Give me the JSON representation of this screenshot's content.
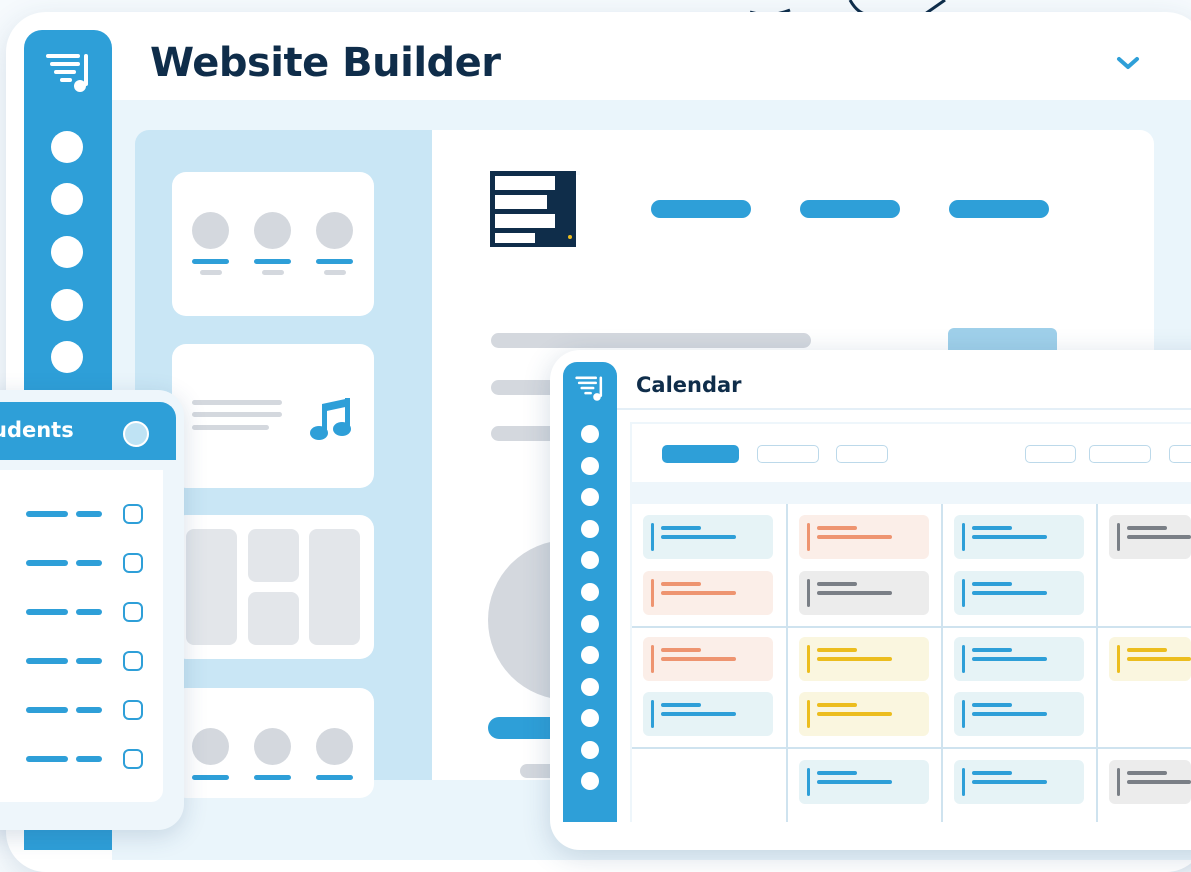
{
  "app": {
    "title": "Website Builder",
    "accent_color": "#2e9fd8",
    "logo_icon": "playlist-music-icon",
    "dropdown_icon": "chevron-down-icon"
  },
  "students_panel": {
    "title": "udents",
    "rows": 6
  },
  "calendar": {
    "title": "Calendar",
    "event_colors": {
      "blue": "#2e9fd8",
      "orange": "#ee9470",
      "gray": "#7a7f86",
      "yellow": "#ecbd1e"
    }
  }
}
